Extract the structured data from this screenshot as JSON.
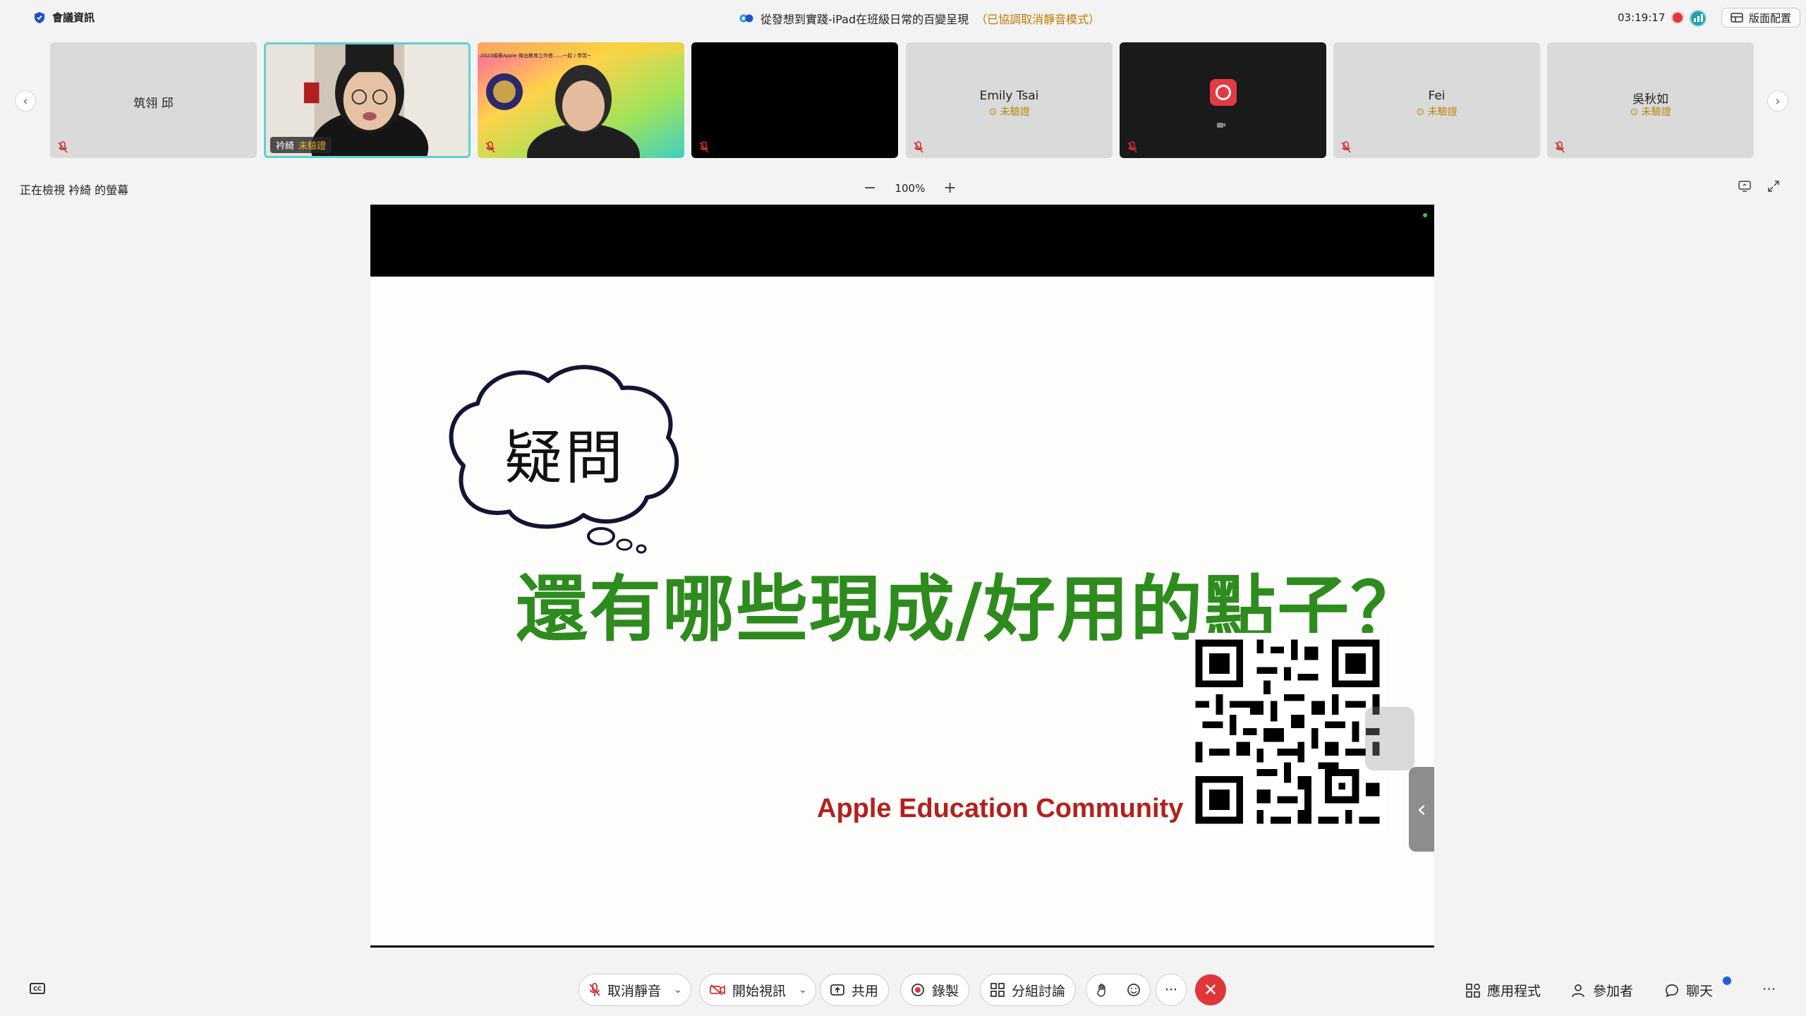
{
  "topbar": {
    "meeting_info_label": "會議資訊",
    "meeting_title": "從發想到實踐-iPad在班級日常的百變呈現",
    "mute_note": "（已協調取消靜音模式）",
    "clock": "03:19:17",
    "layout_button": "版面配置"
  },
  "participants": [
    {
      "name": "筑翎 邱",
      "status": ""
    },
    {
      "name": "衿綺",
      "status": "未驗證"
    },
    {
      "name": "",
      "status": ""
    },
    {
      "name": "",
      "status": ""
    },
    {
      "name": "Emily Tsai",
      "status": "未驗證"
    },
    {
      "name": "",
      "status": ""
    },
    {
      "name": "Fei",
      "status": "未驗證"
    },
    {
      "name": "吳秋如",
      "status": "未驗證"
    }
  ],
  "viewing": {
    "label": "正在檢視 衿綺 的螢幕",
    "zoom": "100%"
  },
  "slide": {
    "cloud_text": "疑問",
    "headline": "還有哪些現成/好用的點子？",
    "brand": "Apple Education Community",
    "banner_text": "2023踏著Apple 傑出教育工作者......一起 / 學習~",
    "colors": {
      "headline": "#2e8b1e",
      "brand": "#b3201e"
    }
  },
  "toolbar": {
    "unmute": "取消靜音",
    "start_video": "開始視訊",
    "share": "共用",
    "record": "錄製",
    "breakout": "分組討論",
    "apps": "應用程式",
    "participants": "參加者",
    "chat": "聊天"
  }
}
